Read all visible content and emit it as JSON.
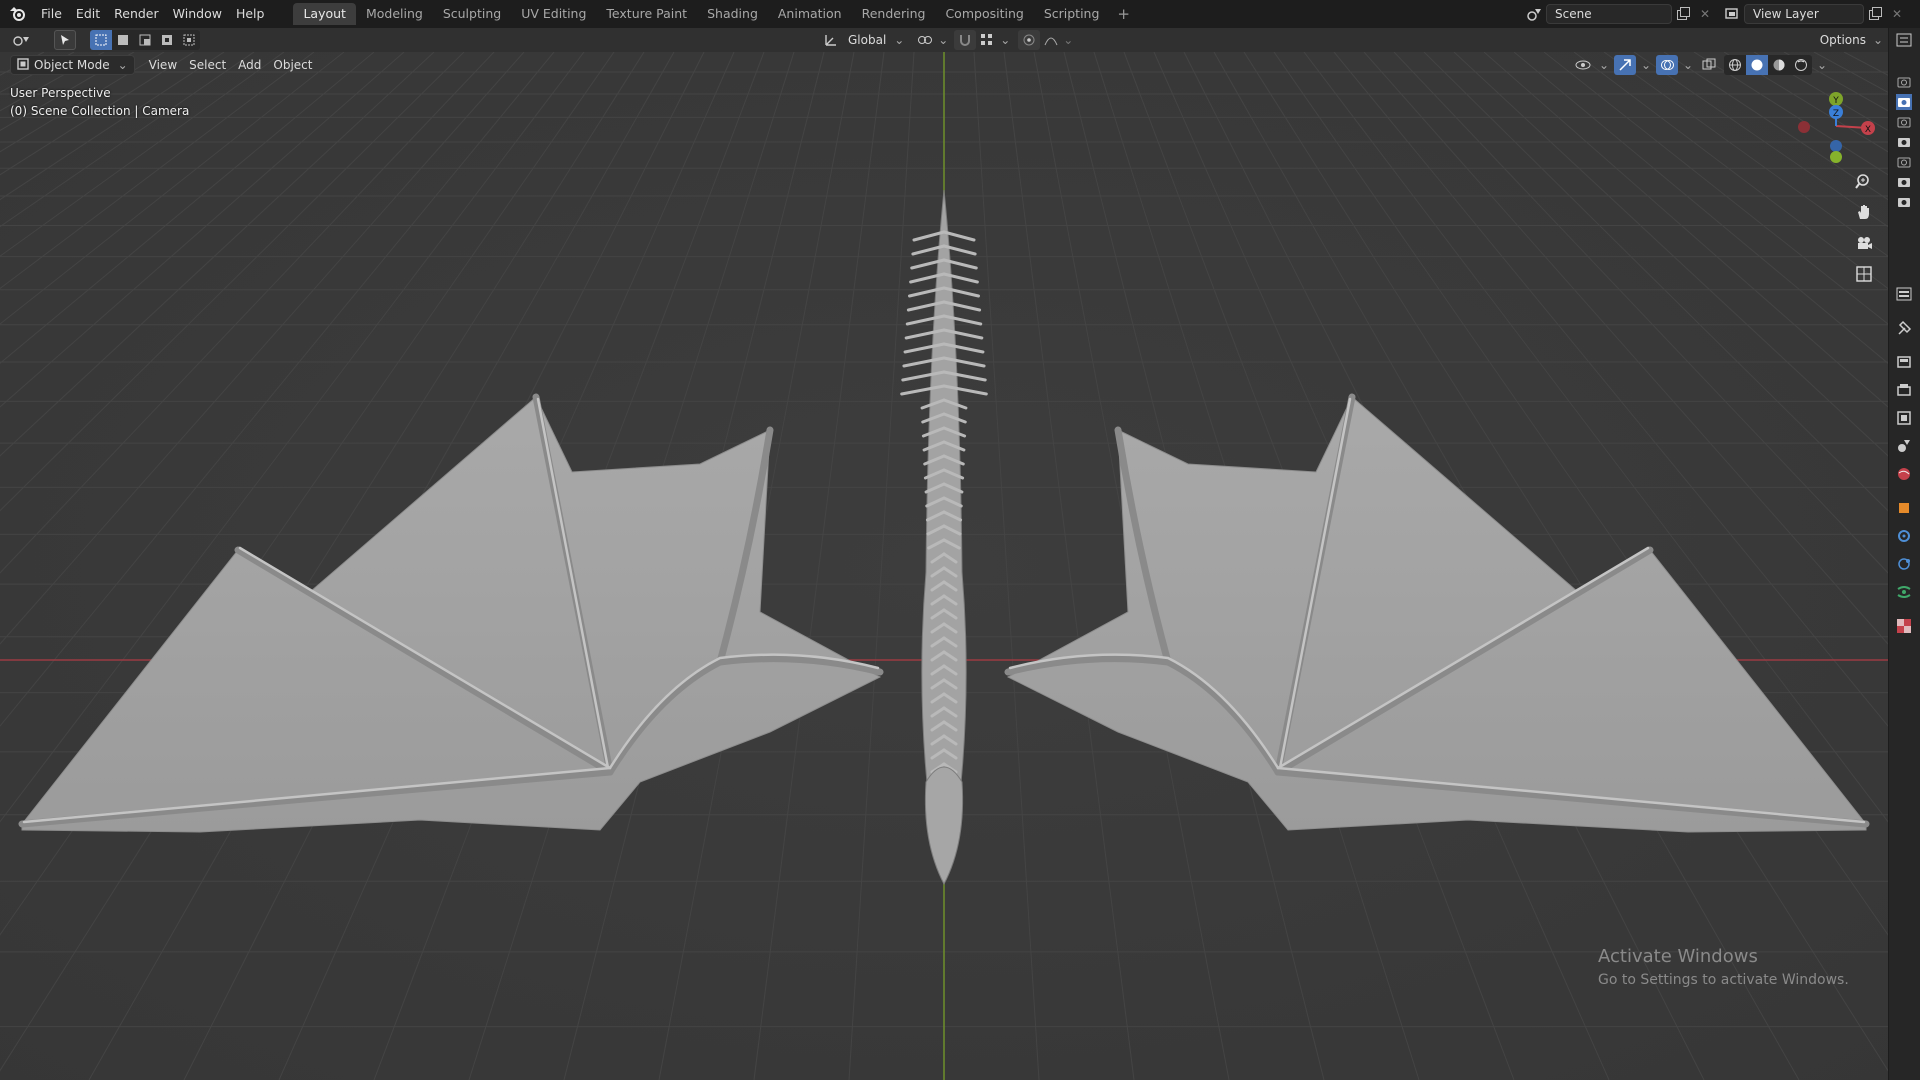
{
  "menu": [
    "File",
    "Edit",
    "Render",
    "Window",
    "Help"
  ],
  "workspaces": [
    {
      "label": "Layout",
      "active": true
    },
    {
      "label": "Modeling",
      "active": false
    },
    {
      "label": "Sculpting",
      "active": false
    },
    {
      "label": "UV Editing",
      "active": false
    },
    {
      "label": "Texture Paint",
      "active": false
    },
    {
      "label": "Shading",
      "active": false
    },
    {
      "label": "Animation",
      "active": false
    },
    {
      "label": "Rendering",
      "active": false
    },
    {
      "label": "Compositing",
      "active": false
    },
    {
      "label": "Scripting",
      "active": false
    }
  ],
  "scene": {
    "name": "Scene"
  },
  "view_layer": {
    "name": "View Layer"
  },
  "toolbar": {
    "transform_orientation": "Global",
    "options_label": "Options"
  },
  "viewport_header": {
    "mode": "Object Mode",
    "view": "View",
    "select": "Select",
    "add": "Add",
    "object": "Object"
  },
  "overlay": {
    "perspective": "User Perspective",
    "collection": "(0) Scene Collection | Camera"
  },
  "gizmo": {
    "x": "X",
    "y": "Y",
    "z": "Z"
  },
  "watermark": {
    "title": "Activate Windows",
    "subtitle": "Go to Settings to activate Windows."
  },
  "colors": {
    "x_axis": "#c4414b",
    "y_axis": "#7ea42a",
    "z_axis": "#3a7fd8",
    "active_tab": "#3d3d3d"
  }
}
